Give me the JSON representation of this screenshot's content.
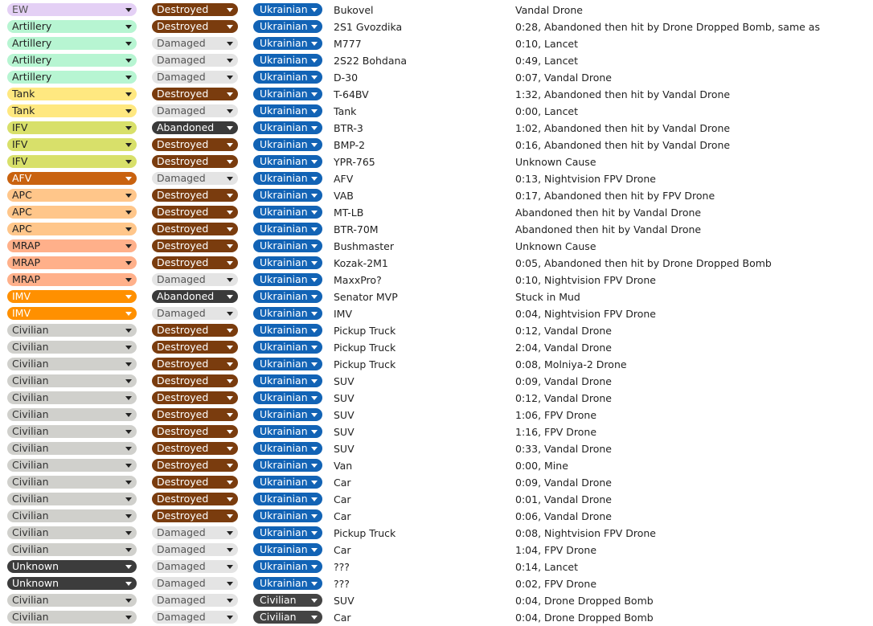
{
  "colors": {
    "types": {
      "EW": {
        "bg": "#e4d0f5",
        "fg": "#555555"
      },
      "Artillery": {
        "bg": "#b7f5d2",
        "fg": "#222222"
      },
      "Tank": {
        "bg": "#ffe880",
        "fg": "#222222"
      },
      "IFV": {
        "bg": "#d8e06a",
        "fg": "#222222"
      },
      "AFV": {
        "bg": "#c9620f",
        "fg": "#ffffff"
      },
      "APC": {
        "bg": "#ffc68a",
        "fg": "#222222"
      },
      "MRAP": {
        "bg": "#ffb08a",
        "fg": "#222222"
      },
      "IMV": {
        "bg": "#ff9000",
        "fg": "#ffffff"
      },
      "Civilian": {
        "bg": "#d0d0cc",
        "fg": "#333333"
      },
      "Unknown": {
        "bg": "#3c3c3c",
        "fg": "#ffffff"
      }
    },
    "statuses": {
      "Destroyed": {
        "bg": "#7a3c0e",
        "fg": "#ffffff"
      },
      "Damaged": {
        "bg": "#e4e4e4",
        "fg": "#555555"
      },
      "Abandoned": {
        "bg": "#3a3a3a",
        "fg": "#ffffff"
      }
    },
    "owners": {
      "Ukrainian": {
        "bg": "#1263b5",
        "fg": "#ffffff"
      },
      "Civilian": {
        "bg": "#444444",
        "fg": "#ffffff"
      }
    }
  },
  "icons": {
    "dropdown": "caret-down-icon"
  },
  "rows": [
    {
      "type": "EW",
      "status": "Destroyed",
      "owner": "Ukrainian",
      "name": "Bukovel",
      "cause": "Vandal Drone"
    },
    {
      "type": "Artillery",
      "status": "Destroyed",
      "owner": "Ukrainian",
      "name": "2S1 Gvozdika",
      "cause": "0:28, Abandoned then hit by Drone Dropped Bomb, same as"
    },
    {
      "type": "Artillery",
      "status": "Damaged",
      "owner": "Ukrainian",
      "name": "M777",
      "cause": "0:10, Lancet"
    },
    {
      "type": "Artillery",
      "status": "Damaged",
      "owner": "Ukrainian",
      "name": "2S22 Bohdana",
      "cause": "0:49, Lancet"
    },
    {
      "type": "Artillery",
      "status": "Damaged",
      "owner": "Ukrainian",
      "name": "D-30",
      "cause": "0:07, Vandal Drone"
    },
    {
      "type": "Tank",
      "status": "Destroyed",
      "owner": "Ukrainian",
      "name": "T-64BV",
      "cause": "1:32, Abandoned then hit by Vandal Drone"
    },
    {
      "type": "Tank",
      "status": "Damaged",
      "owner": "Ukrainian",
      "name": "Tank",
      "cause": "0:00, Lancet"
    },
    {
      "type": "IFV",
      "status": "Abandoned",
      "owner": "Ukrainian",
      "name": "BTR-3",
      "cause": "1:02, Abandoned then hit by Vandal Drone"
    },
    {
      "type": "IFV",
      "status": "Destroyed",
      "owner": "Ukrainian",
      "name": "BMP-2",
      "cause": "0:16, Abandoned then hit by Vandal Drone"
    },
    {
      "type": "IFV",
      "status": "Destroyed",
      "owner": "Ukrainian",
      "name": "YPR-765",
      "cause": "Unknown Cause"
    },
    {
      "type": "AFV",
      "status": "Damaged",
      "owner": "Ukrainian",
      "name": "AFV",
      "cause": "0:13, Nightvision FPV Drone"
    },
    {
      "type": "APC",
      "status": "Destroyed",
      "owner": "Ukrainian",
      "name": "VAB",
      "cause": "0:17, Abandoned then hit by FPV Drone"
    },
    {
      "type": "APC",
      "status": "Destroyed",
      "owner": "Ukrainian",
      "name": "MT-LB",
      "cause": "Abandoned then hit by Vandal Drone"
    },
    {
      "type": "APC",
      "status": "Destroyed",
      "owner": "Ukrainian",
      "name": "BTR-70M",
      "cause": "Abandoned then hit by Vandal Drone"
    },
    {
      "type": "MRAP",
      "status": "Destroyed",
      "owner": "Ukrainian",
      "name": "Bushmaster",
      "cause": "Unknown Cause"
    },
    {
      "type": "MRAP",
      "status": "Destroyed",
      "owner": "Ukrainian",
      "name": "Kozak-2M1",
      "cause": "0:05, Abandoned then hit by Drone Dropped Bomb"
    },
    {
      "type": "MRAP",
      "status": "Damaged",
      "owner": "Ukrainian",
      "name": "MaxxPro?",
      "cause": "0:10, Nightvision FPV Drone"
    },
    {
      "type": "IMV",
      "status": "Abandoned",
      "owner": "Ukrainian",
      "name": "Senator MVP",
      "cause": "Stuck in Mud"
    },
    {
      "type": "IMV",
      "status": "Damaged",
      "owner": "Ukrainian",
      "name": "IMV",
      "cause": "0:04, Nightvision FPV Drone"
    },
    {
      "type": "Civilian",
      "status": "Destroyed",
      "owner": "Ukrainian",
      "name": "Pickup Truck",
      "cause": "0:12, Vandal Drone"
    },
    {
      "type": "Civilian",
      "status": "Destroyed",
      "owner": "Ukrainian",
      "name": "Pickup Truck",
      "cause": "2:04, Vandal Drone"
    },
    {
      "type": "Civilian",
      "status": "Destroyed",
      "owner": "Ukrainian",
      "name": "Pickup Truck",
      "cause": "0:08, Molniya-2 Drone"
    },
    {
      "type": "Civilian",
      "status": "Destroyed",
      "owner": "Ukrainian",
      "name": "SUV",
      "cause": "0:09, Vandal Drone"
    },
    {
      "type": "Civilian",
      "status": "Destroyed",
      "owner": "Ukrainian",
      "name": "SUV",
      "cause": "0:12, Vandal Drone"
    },
    {
      "type": "Civilian",
      "status": "Destroyed",
      "owner": "Ukrainian",
      "name": "SUV",
      "cause": "1:06, FPV Drone"
    },
    {
      "type": "Civilian",
      "status": "Destroyed",
      "owner": "Ukrainian",
      "name": "SUV",
      "cause": "1:16, FPV Drone"
    },
    {
      "type": "Civilian",
      "status": "Destroyed",
      "owner": "Ukrainian",
      "name": "SUV",
      "cause": "0:33, Vandal Drone"
    },
    {
      "type": "Civilian",
      "status": "Destroyed",
      "owner": "Ukrainian",
      "name": "Van",
      "cause": "0:00, Mine"
    },
    {
      "type": "Civilian",
      "status": "Destroyed",
      "owner": "Ukrainian",
      "name": "Car",
      "cause": "0:09, Vandal Drone"
    },
    {
      "type": "Civilian",
      "status": "Destroyed",
      "owner": "Ukrainian",
      "name": "Car",
      "cause": "0:01, Vandal Drone"
    },
    {
      "type": "Civilian",
      "status": "Destroyed",
      "owner": "Ukrainian",
      "name": "Car",
      "cause": "0:06, Vandal Drone"
    },
    {
      "type": "Civilian",
      "status": "Damaged",
      "owner": "Ukrainian",
      "name": "Pickup Truck",
      "cause": "0:08, Nightvision FPV Drone"
    },
    {
      "type": "Civilian",
      "status": "Damaged",
      "owner": "Ukrainian",
      "name": "Car",
      "cause": "1:04, FPV Drone"
    },
    {
      "type": "Unknown",
      "status": "Damaged",
      "owner": "Ukrainian",
      "name": "???",
      "cause": "0:14, Lancet"
    },
    {
      "type": "Unknown",
      "status": "Damaged",
      "owner": "Ukrainian",
      "name": "???",
      "cause": "0:02, FPV Drone"
    },
    {
      "type": "Civilian",
      "status": "Damaged",
      "owner": "Civilian",
      "name": "SUV",
      "cause": "0:04, Drone Dropped Bomb"
    },
    {
      "type": "Civilian",
      "status": "Damaged",
      "owner": "Civilian",
      "name": "Car",
      "cause": "0:04, Drone Dropped Bomb"
    }
  ]
}
